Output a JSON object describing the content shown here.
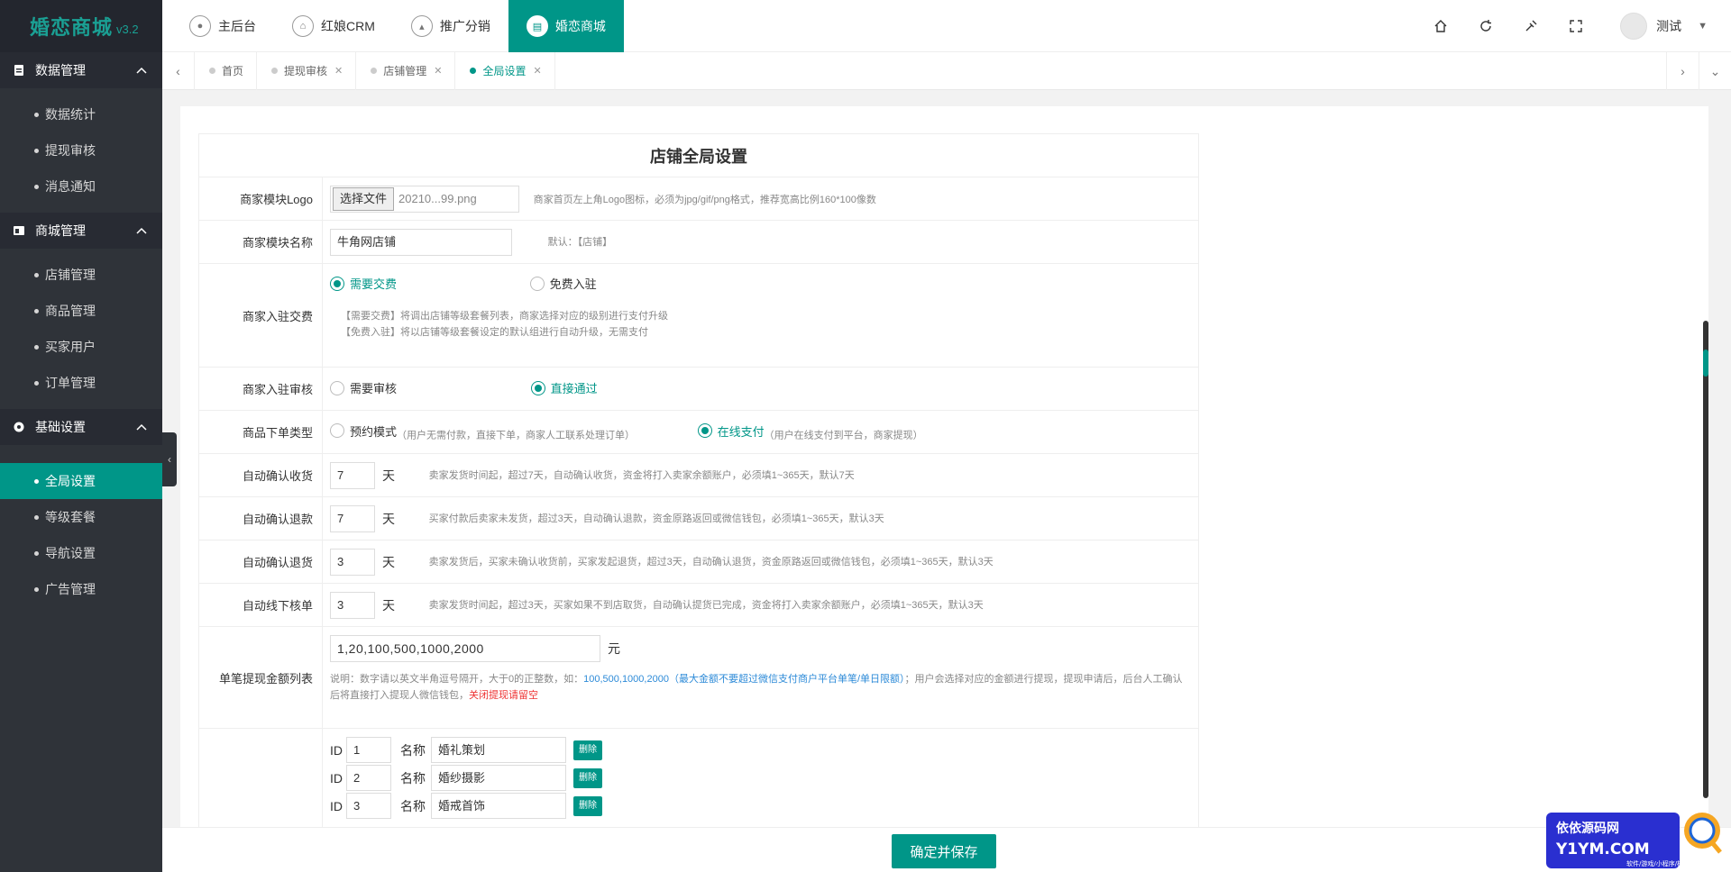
{
  "brand": {
    "name": "婚恋商城",
    "version": "v3.2"
  },
  "sidebar": {
    "groups": [
      {
        "title": "数据管理",
        "items": [
          "数据统计",
          "提现审核",
          "消息通知"
        ]
      },
      {
        "title": "商城管理",
        "items": [
          "店铺管理",
          "商品管理",
          "买家用户",
          "订单管理"
        ]
      },
      {
        "title": "基础设置",
        "items": [
          "全局设置",
          "等级套餐",
          "导航设置",
          "广告管理"
        ]
      }
    ]
  },
  "topnav": {
    "items": [
      "主后台",
      "红娘CRM",
      "推广分销",
      "婚恋商城"
    ]
  },
  "user": {
    "name": "测试"
  },
  "tabs": {
    "items": [
      "首页",
      "提现审核",
      "店铺管理",
      "全局设置"
    ]
  },
  "form": {
    "title": "店铺全局设置",
    "logo": {
      "label": "商家模块Logo",
      "button": "选择文件",
      "file": "20210...99.png",
      "hint": "商家首页左上角Logo图标，必须为jpg/gif/png格式，推荐宽高比例160*100像数"
    },
    "name": {
      "label": "商家模块名称",
      "value": "牛角网店铺",
      "hint": "默认：【店铺】"
    },
    "fee": {
      "label": "商家入驻交费",
      "opt1": "需要交费",
      "opt2": "免费入驻",
      "hint1": "【需要交费】将调出店铺等级套餐列表，商家选择对应的级别进行支付升级",
      "hint2": "【免费入驻】将以店铺等级套餐设定的默认组进行自动升级，无需支付"
    },
    "audit": {
      "label": "商家入驻审核",
      "opt1": "需要审核",
      "opt2": "直接通过"
    },
    "ordertype": {
      "label": "商品下单类型",
      "opt1": "预约模式",
      "opt1_hint": "（用户无需付款，直接下单，商家人工联系处理订单）",
      "opt2": "在线支付",
      "opt2_hint": "（用户在线支付到平台，商家提现）"
    },
    "auto1": {
      "label": "自动确认收货",
      "value": "7",
      "unit": "天",
      "hint": "卖家发货时间起，超过7天，自动确认收货，资金将打入卖家余额账户，必须填1~365天，默认7天"
    },
    "auto2": {
      "label": "自动确认退款",
      "value": "7",
      "unit": "天",
      "hint": "买家付款后卖家未发货，超过3天，自动确认退款，资金原路返回或微信钱包，必须填1~365天，默认3天"
    },
    "auto3": {
      "label": "自动确认退货",
      "value": "3",
      "unit": "天",
      "hint": "卖家发货后，买家未确认收货前，买家发起退货，超过3天，自动确认退货，资金原路返回或微信钱包，必须填1~365天，默认3天"
    },
    "auto4": {
      "label": "自动线下核单",
      "value": "3",
      "unit": "天",
      "hint": "卖家发货时间起，超过3天，买家如果不到店取货，自动确认提货已完成，资金将打入卖家余额账户，必须填1~365天，默认3天"
    },
    "withdraw": {
      "label": "单笔提现金额列表",
      "value": "1,20,100,500,1000,2000",
      "unit": "元",
      "hint_a": "说明：数字请以英文半角逗号隔开，大于0的正整数，如：",
      "hint_example": "100,500,1000,2000（最大金额不要超过微信支付商户平台单笔/单日限额）",
      "hint_b": "；用户会选择对应的金额进行提现，提现申请后，后台人工确认后将直接打入提现人微信钱包，",
      "hint_red": "关闭提现请留空"
    },
    "categories": {
      "id_label": "ID",
      "name_label": "名称",
      "delete_label": "删除",
      "rows": [
        {
          "id": "1",
          "name": "婚礼策划"
        },
        {
          "id": "2",
          "name": "婚纱摄影"
        },
        {
          "id": "3",
          "name": "婚戒首饰"
        }
      ]
    }
  },
  "save_label": "确定并保存",
  "watermark": {
    "line1": "依依源码网",
    "line2": "Y1YM.COM",
    "line3": "软件/游戏/小程序/棋牌"
  },
  "colors": {
    "primary": "#009688",
    "sidebar": "#2f3339",
    "red": "#e33"
  }
}
